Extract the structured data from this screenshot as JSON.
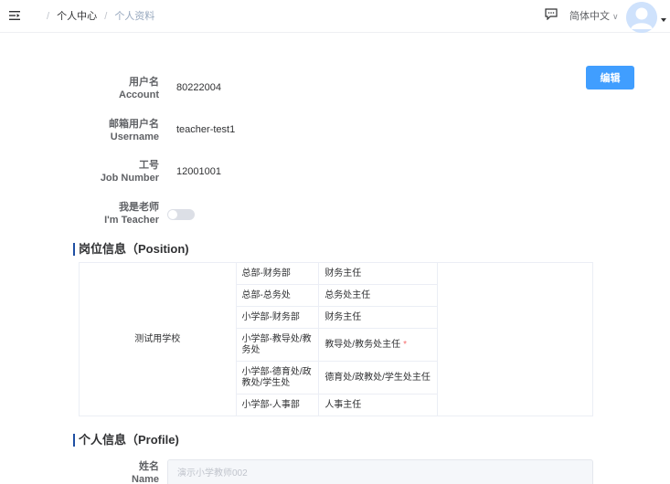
{
  "header": {
    "breadcrumb": {
      "separator": "/",
      "items": [
        "个人中心",
        "个人资料"
      ]
    },
    "language": {
      "selected": "简体中文",
      "caret": "∨"
    },
    "icons": [
      "menu-fold-icon",
      "message-icon",
      "user-avatar-icon",
      "caret-down-icon"
    ]
  },
  "profile": {
    "edit_label": "编辑",
    "fields": {
      "account": {
        "label_cn": "用户名",
        "label_en": "Account",
        "value": "80222004"
      },
      "username": {
        "label_cn": "邮箱用户名",
        "label_en": "Username",
        "value": "teacher-test1"
      },
      "job": {
        "label_cn": "工号",
        "label_en": "Job Number",
        "value": "12001001"
      },
      "teacher": {
        "label_cn": "我是老师",
        "label_en": "I'm Teacher",
        "checked": false
      }
    }
  },
  "position": {
    "title": "岗位信息（Position)",
    "school": "测试用学校",
    "rows": [
      {
        "dept": "总部-财务部",
        "role": "财务主任",
        "required": false
      },
      {
        "dept": "总部-总务处",
        "role": "总务处主任",
        "required": false
      },
      {
        "dept": "小学部-财务部",
        "role": "财务主任",
        "required": false
      },
      {
        "dept": "小学部-教导处/教务处",
        "role": "教导处/教务处主任",
        "required": true,
        "required_mark": "*"
      },
      {
        "dept": "小学部-德育处/政教处/学生处",
        "role": "德育处/政教处/学生处主任",
        "required": false
      },
      {
        "dept": "小学部-人事部",
        "role": "人事主任",
        "required": false
      }
    ]
  },
  "personal": {
    "title": "个人信息（Profile)",
    "name": {
      "label_cn": "姓名",
      "label_en": "Name",
      "placeholder": "演示小学教师002"
    }
  },
  "colors": {
    "primary": "#409eff",
    "section_bar": "#1f4fa3",
    "required": "#f56c6c"
  }
}
